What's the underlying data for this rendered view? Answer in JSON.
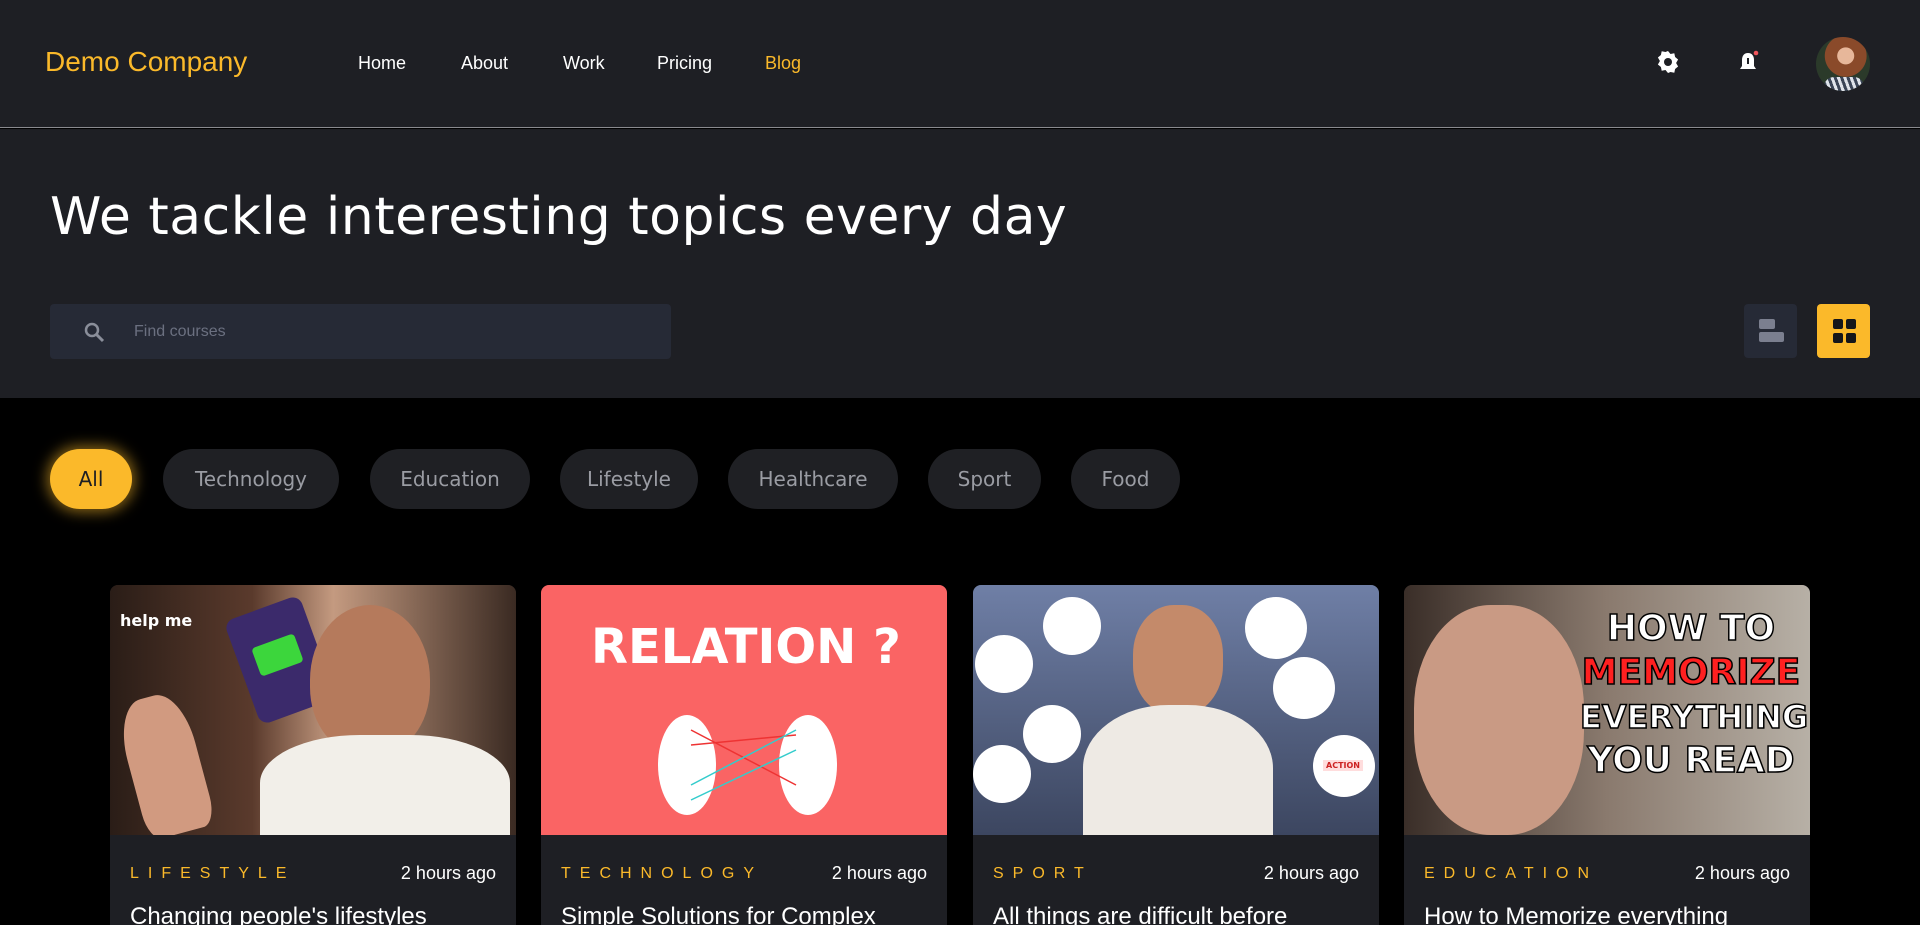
{
  "header": {
    "logo": "Demo Company",
    "nav": [
      {
        "label": "Home"
      },
      {
        "label": "About"
      },
      {
        "label": "Work"
      },
      {
        "label": "Pricing"
      },
      {
        "label": "Blog",
        "active": true
      }
    ],
    "icons": [
      "gear-icon",
      "bell-icon",
      "avatar"
    ]
  },
  "hero": {
    "title": "We tackle interesting topics every day",
    "search": {
      "placeholder": "Find courses",
      "value": ""
    },
    "view_modes": {
      "list": "list-view-icon",
      "grid": "grid-view-icon",
      "active": "grid"
    }
  },
  "filters": [
    {
      "label": "All",
      "active": true
    },
    {
      "label": "Technology"
    },
    {
      "label": "Education"
    },
    {
      "label": "Lifestyle"
    },
    {
      "label": "Healthcare"
    },
    {
      "label": "Sport"
    },
    {
      "label": "Food"
    }
  ],
  "cards": [
    {
      "category": "LIFESTYLE",
      "time": "2 hours ago",
      "title": "Changing people's lifestyles",
      "image_text": "help me"
    },
    {
      "category": "TECHNOLOGY",
      "time": "2 hours ago",
      "title": "Simple Solutions for Complex",
      "image_text": "RELATION ?"
    },
    {
      "category": "SPORT",
      "time": "2 hours ago",
      "title": "All things are difficult before",
      "image_text": "ACTION"
    },
    {
      "category": "EDUCATION",
      "time": "2 hours ago",
      "title": "How to Memorize everything",
      "image_text": [
        "HOW TO",
        "MEMORIZE",
        "EVERYTHING",
        "YOU READ"
      ]
    }
  ],
  "colors": {
    "accent": "#fbb92a",
    "surface": "#1e1f24",
    "background": "#000000"
  }
}
